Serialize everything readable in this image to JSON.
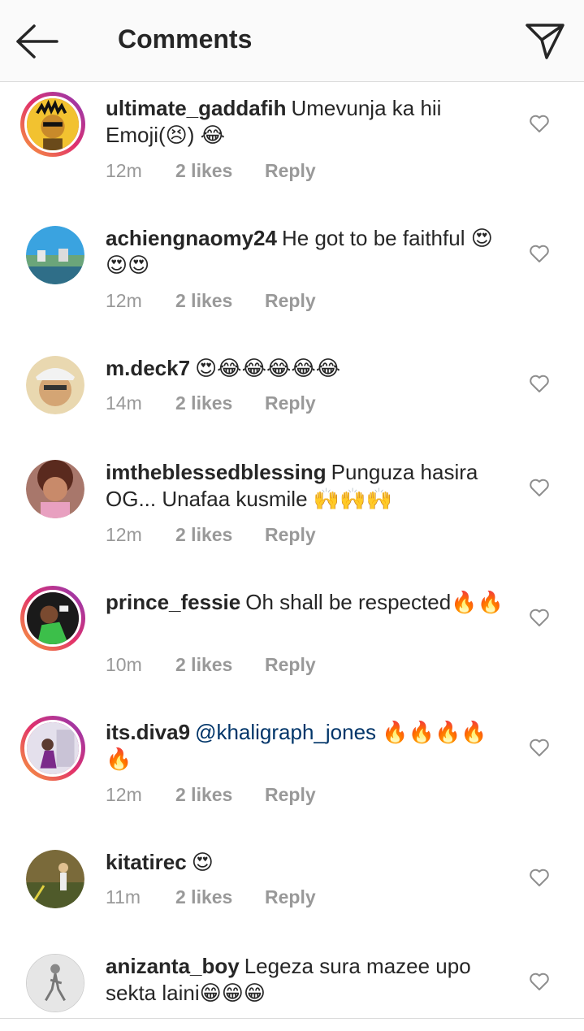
{
  "header": {
    "title": "Comments",
    "back_icon": "arrow-left-icon",
    "send_icon": "paper-plane-icon"
  },
  "comments": [
    {
      "username": "ultimate_gaddafih",
      "text": "Umevunja ka hii Emoji(😣) 😂",
      "time": "12m",
      "likes": "2 likes",
      "reply": "Reply",
      "story_ring": true
    },
    {
      "username": "achiengnaomy24",
      "text": "He got to be faithful 😍😍😍",
      "time": "12m",
      "likes": "2 likes",
      "reply": "Reply",
      "story_ring": false
    },
    {
      "username": "m.deck7",
      "text": "😍😂😂😂😂😂",
      "time": "14m",
      "likes": "2 likes",
      "reply": "Reply",
      "story_ring": false
    },
    {
      "username": "imtheblessedblessing",
      "text": "Punguza hasira OG... Unafaa kusmile 🙌🙌🙌",
      "time": "12m",
      "likes": "2 likes",
      "reply": "Reply",
      "story_ring": false
    },
    {
      "username": "prince_fessie",
      "text": "Oh shall be respected🔥🔥",
      "time": "10m",
      "likes": "2 likes",
      "reply": "Reply",
      "story_ring": true
    },
    {
      "username": "its.diva9",
      "mention": "@khaligraph_jones",
      "text": "🔥🔥🔥🔥🔥",
      "time": "12m",
      "likes": "2 likes",
      "reply": "Reply",
      "story_ring": true
    },
    {
      "username": "kitatirec",
      "text": "😍",
      "time": "11m",
      "likes": "2 likes",
      "reply": "Reply",
      "story_ring": false
    },
    {
      "username": "anizanta_boy",
      "text": "Legeza sura mazee upo sekta laini😁😁😁",
      "story_ring": false
    }
  ],
  "colors": {
    "text": "#262626",
    "meta": "#999999",
    "mention": "#003569",
    "divider": "#dbdbdb"
  }
}
